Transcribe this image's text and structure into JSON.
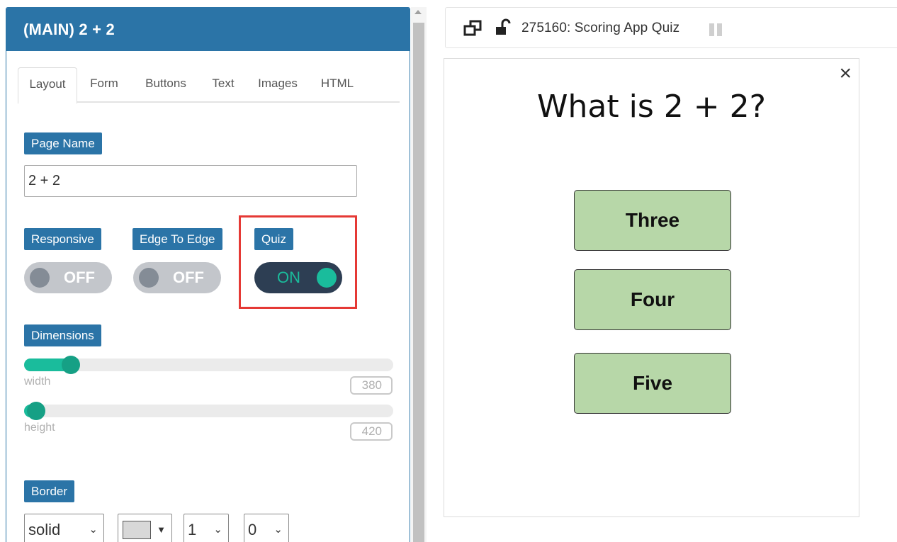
{
  "panel": {
    "title": "(MAIN) 2 + 2",
    "tabs": [
      {
        "label": "Layout",
        "active": true
      },
      {
        "label": "Form"
      },
      {
        "label": "Buttons"
      },
      {
        "label": "Text"
      },
      {
        "label": "Images"
      },
      {
        "label": "HTML"
      }
    ],
    "page_name": {
      "label": "Page Name",
      "value": "2 + 2"
    },
    "responsive": {
      "label": "Responsive",
      "state": "OFF"
    },
    "edge_to_edge": {
      "label": "Edge To Edge",
      "state": "OFF"
    },
    "quiz": {
      "label": "Quiz",
      "state": "ON"
    },
    "dimensions": {
      "label": "Dimensions",
      "width": {
        "caption": "width",
        "value": "380"
      },
      "height": {
        "caption": "height",
        "value": "420"
      }
    },
    "border": {
      "label": "Border",
      "style": "solid",
      "width": "1",
      "radius": "0"
    }
  },
  "preview": {
    "title": "275160: Scoring App Quiz",
    "question": "What is 2 + 2?",
    "answers": [
      "Three",
      "Four",
      "Five"
    ],
    "close": "×"
  },
  "colors": {
    "primary": "#2b74a7",
    "toggle_on": "#2d3e53",
    "accent": "#1abc9c",
    "answer_bg": "#b7d7a8",
    "highlight": "#e53935"
  }
}
